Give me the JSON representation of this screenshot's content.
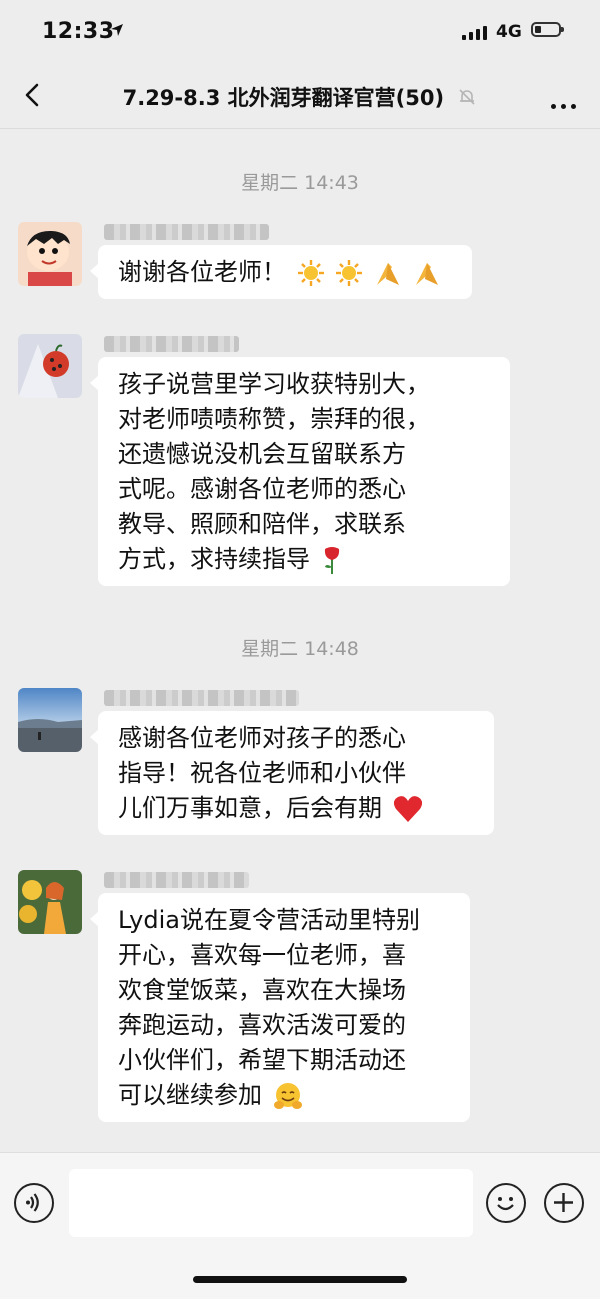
{
  "status_bar": {
    "time": "12:33",
    "network": "4G"
  },
  "nav": {
    "title": "7.29-8.3 北外润芽翻译官营(50)"
  },
  "messages": {
    "ts1": "星期二 14:43",
    "m1": {
      "line1": "谢谢各位老师！"
    },
    "m2": {
      "line1": "孩子说营里学习收获特别大，",
      "line2": "对老师啧啧称赞，崇拜的很，",
      "line3": "还遗憾说没机会互留联系方",
      "line4": "式呢。感谢各位老师的悉心",
      "line5": "教导、照顾和陪伴，求联系",
      "line6": "方式，求持续指导"
    },
    "ts2": "星期二 14:48",
    "m3": {
      "line1": "感谢各位老师对孩子的悉心",
      "line2": "指导！祝各位老师和小伙伴",
      "line3": "儿们万事如意，后会有期"
    },
    "m4": {
      "line1": "Lydia说在夏令营活动里特别",
      "line2": "开心，喜欢每一位老师，喜",
      "line3": "欢食堂饭菜，喜欢在大操场",
      "line4": "奔跑运动，喜欢活泼可爱的",
      "line5": "小伙伴们，希望下期活动还",
      "line6": "可以继续参加"
    }
  },
  "icons": {
    "m1_emojis": [
      "sun-icon",
      "sun-icon",
      "praying-hands-icon",
      "praying-hands-icon"
    ],
    "m2_emoji": "rose-icon",
    "m3_emoji": "red-heart-icon",
    "m4_emoji": "hugging-face-icon",
    "input_bar": [
      "voice-icon",
      "smiley-icon",
      "plus-icon"
    ]
  },
  "colors": {
    "background": "#ededed",
    "bubble": "#ffffff",
    "timestamp": "#9a9a9a",
    "heart": "#e0282e",
    "sun": "#f5a623"
  }
}
